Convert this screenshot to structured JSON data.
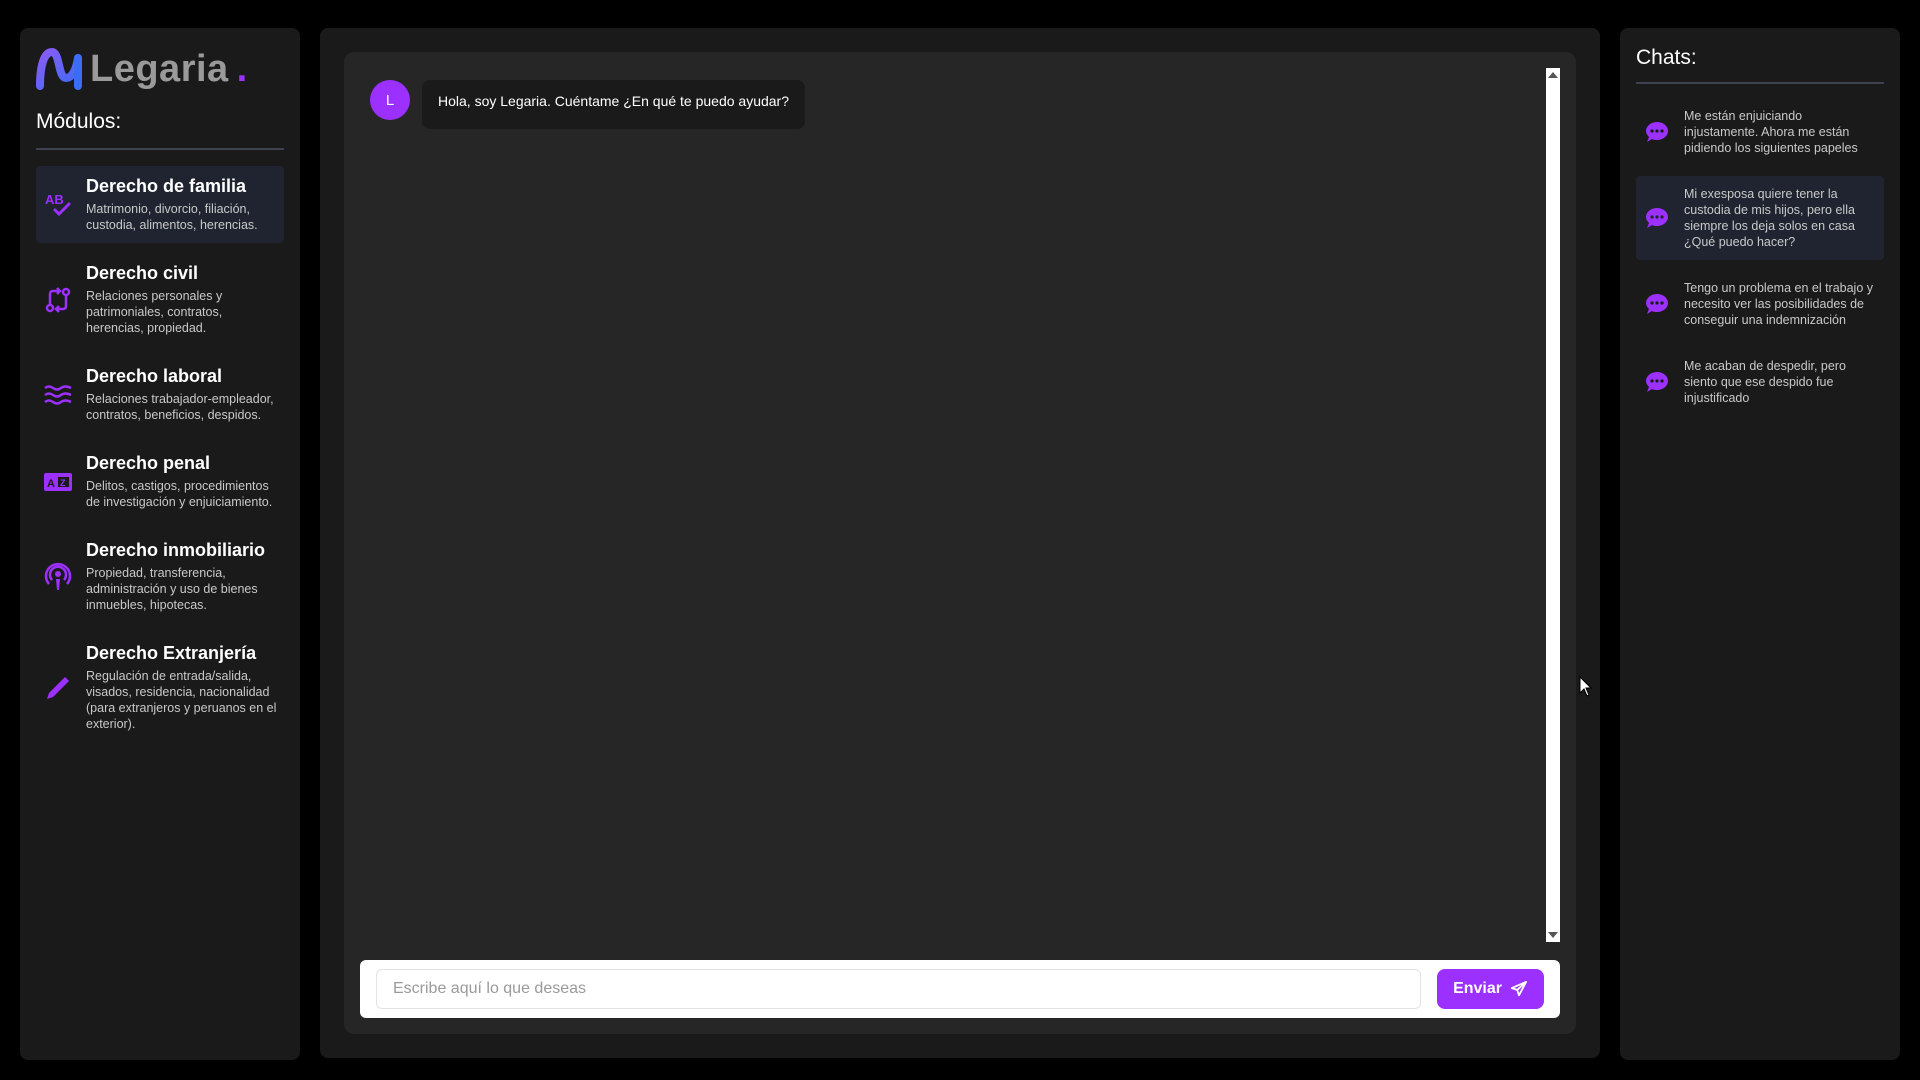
{
  "brand": {
    "name": "Legaria",
    "dot": ".",
    "accent_color": "#9b30ff"
  },
  "sidebar": {
    "title": "Módulos:",
    "modules": [
      {
        "title": "Derecho de familia",
        "desc": "Matrimonio, divorcio, filiación, custodia, alimentos, herencias.",
        "icon": "spellcheck-icon",
        "active": true
      },
      {
        "title": "Derecho civil",
        "desc": "Relaciones personales y patrimoniales, contratos, herencias, propiedad.",
        "icon": "exchange-icon",
        "active": false
      },
      {
        "title": "Derecho laboral",
        "desc": "Relaciones trabajador-empleador, contratos, beneficios, despidos.",
        "icon": "waves-icon",
        "active": false
      },
      {
        "title": "Derecho penal",
        "desc": "Delitos, castigos, procedimientos de investigación y enjuiciamiento.",
        "icon": "id-card-icon",
        "active": false
      },
      {
        "title": "Derecho inmobiliario",
        "desc": "Propiedad, transferencia, administración y uso de bienes inmuebles, hipotecas.",
        "icon": "podcast-icon",
        "active": false
      },
      {
        "title": "Derecho Extranjería",
        "desc": "Regulación de entrada/salida, visados, residencia, nacionalidad (para extranjeros y peruanos en el exterior).",
        "icon": "pen-icon",
        "active": false
      }
    ]
  },
  "conversation": {
    "messages": [
      {
        "avatar": "L",
        "text": "Hola, soy Legaria. Cuéntame ¿En qué te puedo ayudar?"
      }
    ],
    "input_placeholder": "Escribe aquí lo que deseas",
    "send_label": "Enviar"
  },
  "chats": {
    "title": "Chats:",
    "items": [
      {
        "text": "Me están enjuiciando injustamente. Ahora me están pidiendo los siguientes papeles",
        "active": false
      },
      {
        "text": "Mi exesposa quiere tener la custodia de mis hijos, pero ella siempre los deja solos en casa ¿Qué puedo hacer?",
        "active": true
      },
      {
        "text": "Tengo un problema en el trabajo y necesito ver las posibilidades de conseguir una indemnización",
        "active": false
      },
      {
        "text": "Me acaban de despedir, pero siento que ese despido fue injustificado",
        "active": false
      }
    ]
  }
}
